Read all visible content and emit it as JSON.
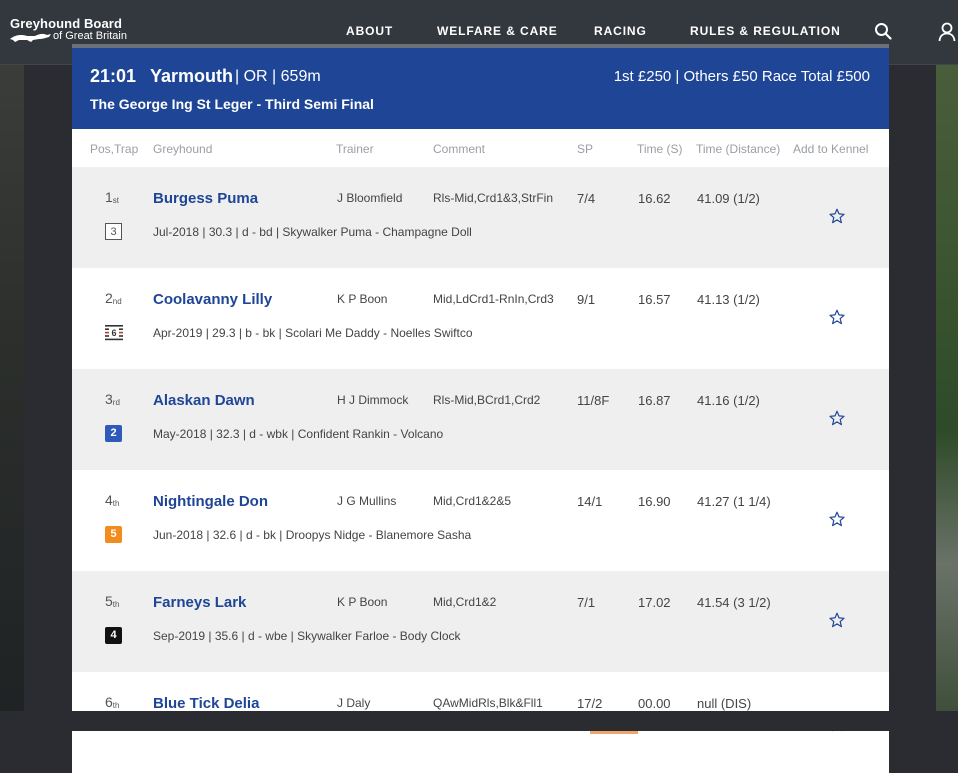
{
  "nav": {
    "logo_line1": "Greyhound Board",
    "logo_line2": "of Great Britain",
    "links": [
      "ABOUT",
      "WELFARE & CARE",
      "RACING",
      "RULES & REGULATION"
    ]
  },
  "race": {
    "time": "21:01",
    "venue": "Yarmouth",
    "meta": "| OR | 659m",
    "prize": "1st £250 | Others £50 Race Total £500",
    "title": "The George Ing St Leger - Third Semi Final"
  },
  "columns": [
    "Pos,Trap",
    "Greyhound",
    "Trainer",
    "Comment",
    "SP",
    "Time (S)",
    "Time (Distance)",
    "Add to Kennel"
  ],
  "runners": [
    {
      "pos": "1",
      "suffix": "st",
      "trap": "3",
      "name": "Burgess Puma",
      "trainer": "J Bloomfield",
      "comment": "Rls-Mid,Crd1&3,StrFin",
      "sp": "7/4",
      "time": "16.62",
      "distance": "41.09 (1/2)",
      "details": "Jul-2018 | 30.3 | d - bd | Skywalker Puma - Champagne Doll"
    },
    {
      "pos": "2",
      "suffix": "nd",
      "trap": "6",
      "name": "Coolavanny Lilly",
      "trainer": "K P Boon",
      "comment": "Mid,LdCrd1-RnIn,Crd3",
      "sp": "9/1",
      "time": "16.57",
      "distance": "41.13 (1/2)",
      "details": "Apr-2019 | 29.3 | b - bk | Scolari Me Daddy - Noelles Swiftco"
    },
    {
      "pos": "3",
      "suffix": "rd",
      "trap": "2",
      "name": "Alaskan Dawn",
      "trainer": "H J Dimmock",
      "comment": "Rls-Mid,BCrd1,Crd2",
      "sp": "11/8F",
      "time": "16.87",
      "distance": "41.16 (1/2)",
      "details": "May-2018 | 32.3 | d - wbk | Confident Rankin - Volcano"
    },
    {
      "pos": "4",
      "suffix": "th",
      "trap": "5",
      "name": "Nightingale Don",
      "trainer": "J G Mullins",
      "comment": "Mid,Crd1&2&5",
      "sp": "14/1",
      "time": "16.90",
      "distance": "41.27 (1 1/4)",
      "details": "Jun-2018 | 32.6 | d - bk | Droopys Nidge - Blanemore Sasha"
    },
    {
      "pos": "5",
      "suffix": "th",
      "trap": "4",
      "name": "Farneys Lark",
      "trainer": "K P Boon",
      "comment": "Mid,Crd1&2",
      "sp": "7/1",
      "time": "17.02",
      "distance": "41.54 (3 1/2)",
      "details": "Sep-2019 | 35.6 | d - wbe | Skywalker Farloe - Body Clock"
    },
    {
      "pos": "6",
      "suffix": "th",
      "trap": "",
      "name": "Blue Tick Delia",
      "trainer": "J Daly",
      "comment": "QAwMidRls,Blk&Fll1",
      "sp": "17/2",
      "time": "00.00",
      "distance": "null (DIS)",
      "details": ""
    }
  ],
  "colors": {
    "header_blue": "#1e4596",
    "name_blue": "#1e4596",
    "trap2": "#2f5ab9",
    "trap5": "#f28c1c",
    "trap4": "#111111"
  }
}
